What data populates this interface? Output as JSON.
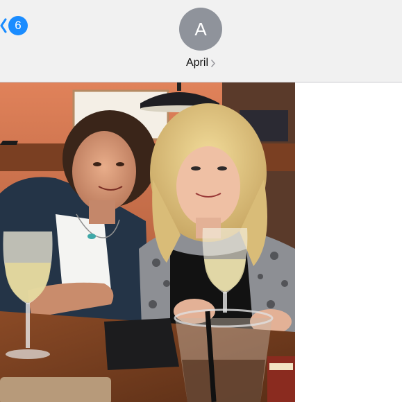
{
  "header": {
    "back_badge_count": "6",
    "contact": {
      "avatar_initial": "A",
      "name": "April"
    }
  },
  "message": {
    "attachment_type": "photo"
  },
  "icons": {
    "back": "chevron-left-icon",
    "contact_details": "chevron-right-icon"
  },
  "colors": {
    "accent": "#1a8cff",
    "avatar": "#8f939b",
    "header_bg": "#f1f1f1"
  }
}
